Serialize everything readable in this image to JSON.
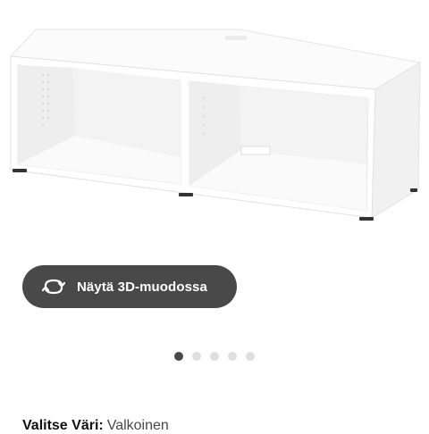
{
  "product": {
    "image_icon": "white-tv-bench-image"
  },
  "view_3d": {
    "label": "Näytä 3D-muodossa",
    "icon": "rotate-3d-icon",
    "background": "#494949"
  },
  "carousel": {
    "count": 5,
    "active_index": 0,
    "active_color": "#484848",
    "inactive_color": "#dfdfdf"
  },
  "color_select": {
    "label": "Valitse Väri:",
    "value": "Valkoinen"
  }
}
